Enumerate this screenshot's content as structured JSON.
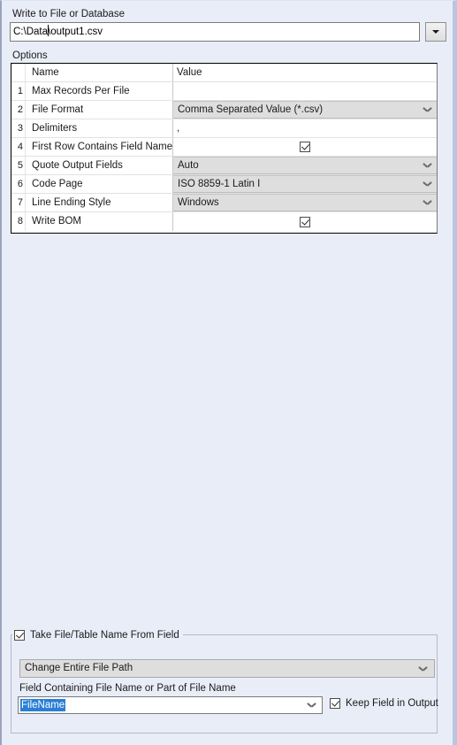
{
  "header": {
    "write_label": "Write to File or Database",
    "path_value_before_caret": "C:\\Data",
    "path_value_after_caret": "\\output1.csv",
    "path_full_value": "C:\\Data\\output1.csv",
    "dropdown_icon": "triangle-down-icon"
  },
  "options": {
    "section_label": "Options",
    "columns": [
      "",
      "Name",
      "Value"
    ],
    "rows": [
      {
        "index": "",
        "name": "Name",
        "value": "Value",
        "kind": "header"
      },
      {
        "index": "1",
        "name": "Max Records Per File",
        "value": "",
        "kind": "text"
      },
      {
        "index": "2",
        "name": "File Format",
        "value": "Comma Separated Value (*.csv)",
        "kind": "combo"
      },
      {
        "index": "3",
        "name": "Delimiters",
        "value": ",",
        "kind": "text"
      },
      {
        "index": "4",
        "name": "First Row Contains Field Names",
        "value": "",
        "kind": "checkbox",
        "checked": true
      },
      {
        "index": "5",
        "name": "Quote Output Fields",
        "value": "Auto",
        "kind": "combo"
      },
      {
        "index": "6",
        "name": "Code Page",
        "value": "ISO 8859-1 Latin I",
        "kind": "combo"
      },
      {
        "index": "7",
        "name": "Line Ending Style",
        "value": "Windows",
        "kind": "combo"
      },
      {
        "index": "8",
        "name": "Write BOM",
        "value": "",
        "kind": "checkbox",
        "checked": true
      }
    ]
  },
  "bottom": {
    "group_checkbox_label": "Take File/Table Name From Field",
    "group_checkbox_checked": true,
    "mode_value": "Change Entire File Path",
    "field_label": "Field Containing File Name or Part of File Name",
    "field_value": "FileName",
    "keep_field_label": "Keep Field in Output",
    "keep_field_checked": true
  },
  "colors": {
    "panel_background": "#e9edf7",
    "grid_background": "#ffffff",
    "combo_background": "#dedede",
    "selection_blue": "#2a7fd4",
    "border_dark": "#000000"
  }
}
